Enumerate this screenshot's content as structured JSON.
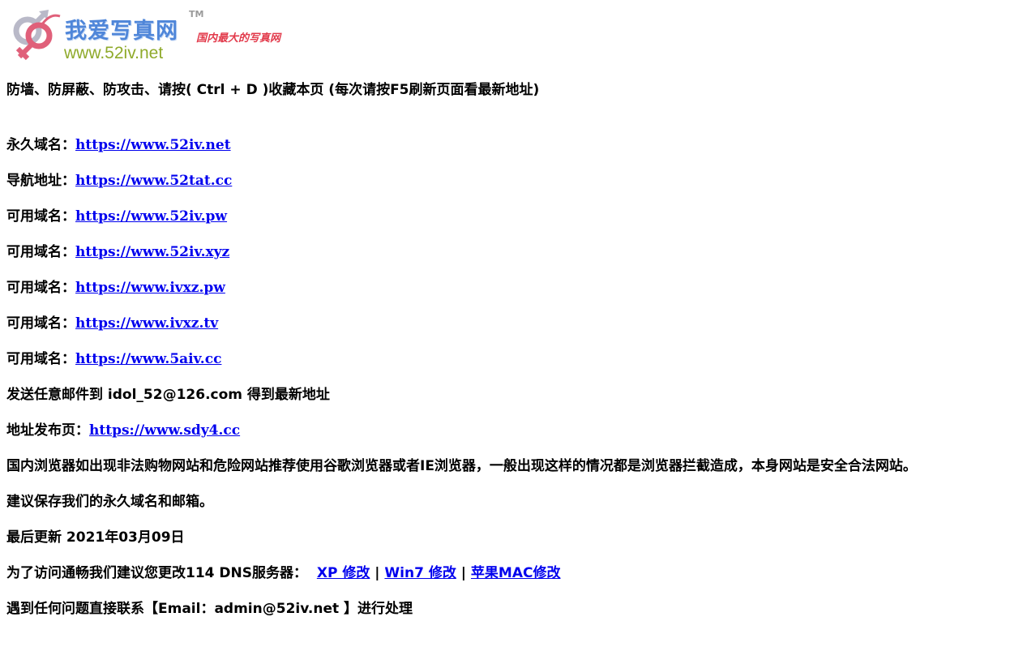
{
  "logo": {
    "title": "我爱写真网",
    "tm": "TM",
    "slogan": "国内最大的写真网",
    "url": "www.52iv.net",
    "colors": {
      "title": "#4f86d9",
      "slogan": "#e23a4b",
      "url": "#8faa2b",
      "mark_primary": "#e0607a",
      "mark_secondary": "#b9b9c8"
    }
  },
  "notice": "防墙、防屏蔽、防攻击、请按( Ctrl + D )收藏本页 (每次请按F5刷新页面看最新地址)",
  "domains": [
    {
      "label": "永久域名：",
      "url": "https://www.52iv.net"
    },
    {
      "label": "导航地址：",
      "url": "https://www.52tat.cc"
    },
    {
      "label": "可用域名：",
      "url": "https://www.52iv.pw"
    },
    {
      "label": "可用域名：",
      "url": "https://www.52iv.xyz"
    },
    {
      "label": "可用域名：",
      "url": "https://www.ivxz.pw"
    },
    {
      "label": "可用域名：",
      "url": "https://www.ivxz.tv"
    },
    {
      "label": "可用域名：",
      "url": "https://www.5aiv.cc"
    }
  ],
  "email_line": "发送任意邮件到 idol_52@126.com 得到最新地址",
  "publish": {
    "label": "地址发布页：",
    "url": "https://www.sdy4.cc"
  },
  "browser_notice": "国内浏览器如出现非法购物网站和危险网站推荐使用谷歌浏览器或者IE浏览器，一般出现这样的情况都是浏览器拦截造成，本身网站是安全合法网站。",
  "save_notice": "建议保存我们的永久域名和邮箱。",
  "last_update": "最后更新 2021年03月09日",
  "dns": {
    "text": "为了访问通畅我们建议您更改114 DNS服务器：",
    "links": [
      "XP 修改",
      "Win7 修改",
      "苹果MAC修改"
    ],
    "separator": "|"
  },
  "contact": "遇到任何问题直接联系【Email：admin@52iv.net 】进行处理"
}
